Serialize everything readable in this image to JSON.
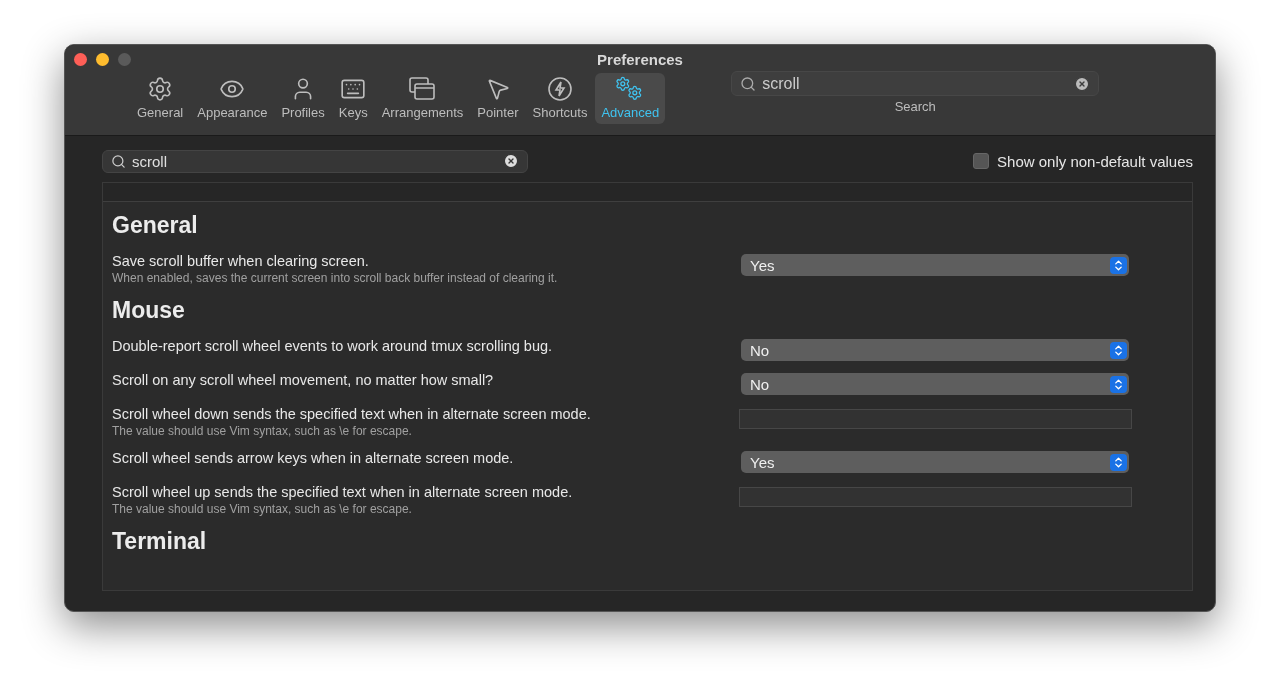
{
  "window": {
    "title": "Preferences"
  },
  "tabs": [
    {
      "label": "General",
      "selected": false
    },
    {
      "label": "Appearance",
      "selected": false
    },
    {
      "label": "Profiles",
      "selected": false
    },
    {
      "label": "Keys",
      "selected": false
    },
    {
      "label": "Arrangements",
      "selected": false
    },
    {
      "label": "Pointer",
      "selected": false
    },
    {
      "label": "Shortcuts",
      "selected": false
    },
    {
      "label": "Advanced",
      "selected": true
    }
  ],
  "toolbar_search": {
    "value": "scroll",
    "label": "Search"
  },
  "filter": {
    "value": "scroll"
  },
  "non_default_checkbox": {
    "label": "Show only non-default values",
    "checked": false
  },
  "sections": [
    {
      "title": "General",
      "items": [
        {
          "kind": "popup",
          "label": "Save scroll buffer when clearing screen.",
          "hint": "When enabled, saves the current screen into scroll back buffer instead of clearing it.",
          "value": "Yes"
        }
      ]
    },
    {
      "title": "Mouse",
      "items": [
        {
          "kind": "popup",
          "label": "Double-report scroll wheel events to work around tmux scrolling bug.",
          "value": "No"
        },
        {
          "kind": "popup",
          "label": "Scroll on any scroll wheel movement, no matter how small?",
          "value": "No"
        },
        {
          "kind": "text",
          "label": "Scroll wheel down sends the specified text when in alternate screen mode.",
          "hint": "The value should use Vim syntax, such as \\e for escape."
        },
        {
          "kind": "popup",
          "label": "Scroll wheel sends arrow keys when in alternate screen mode.",
          "value": "Yes"
        },
        {
          "kind": "text",
          "label": "Scroll wheel up sends the specified text when in alternate screen mode.",
          "hint": "The value should use Vim syntax, such as \\e for escape."
        }
      ]
    },
    {
      "title": "Terminal"
    }
  ]
}
